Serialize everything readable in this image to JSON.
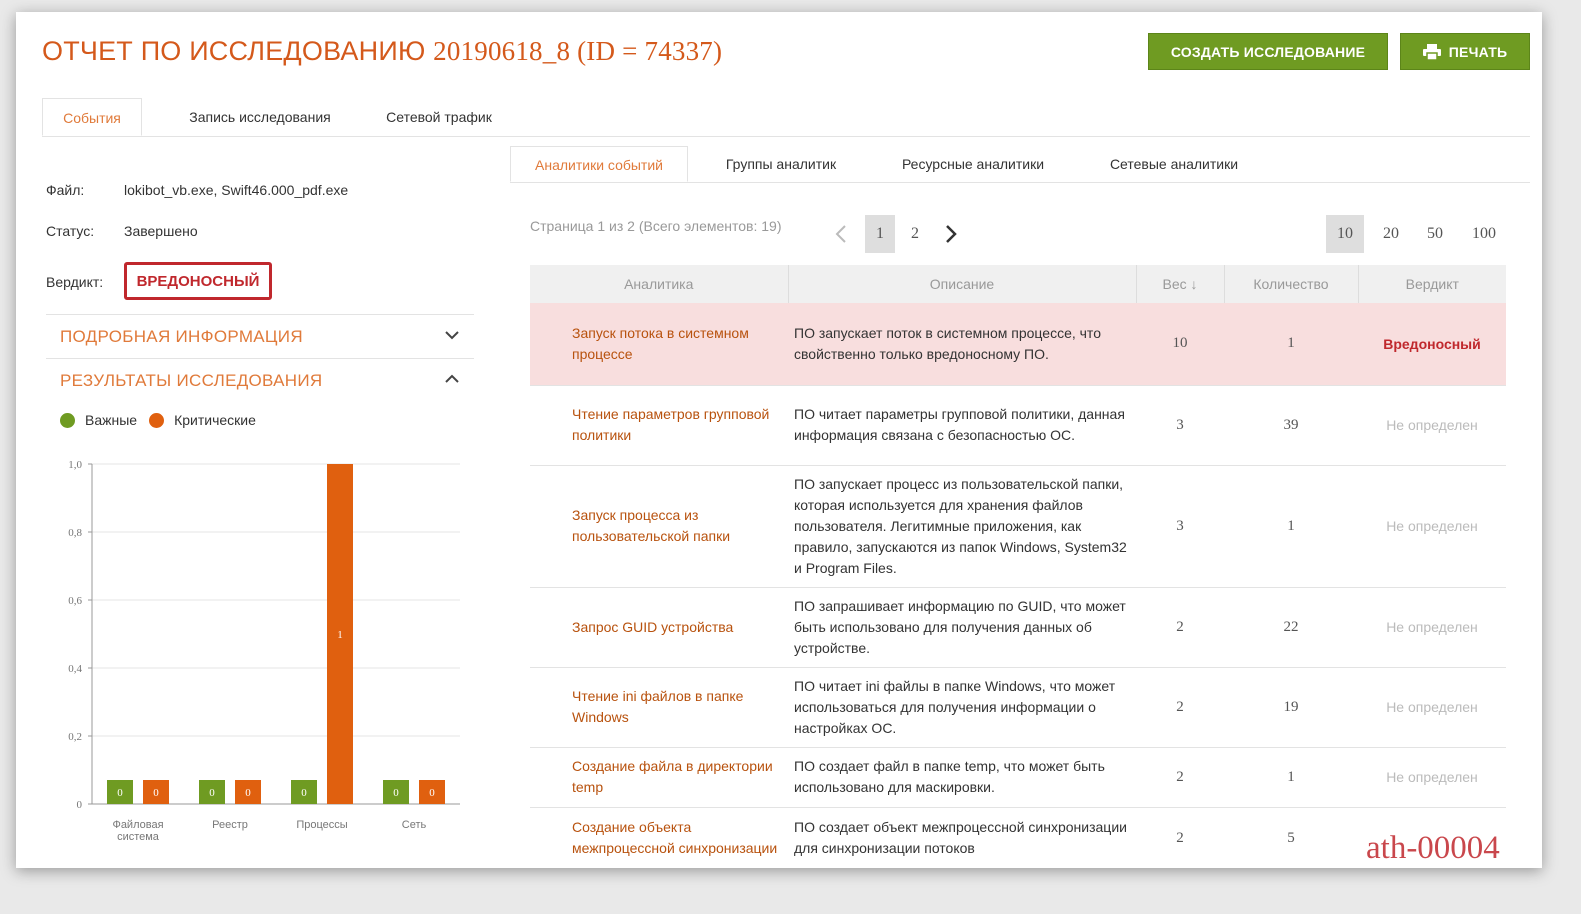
{
  "header": {
    "title_prefix": "ОТЧЕТ ПО ИССЛЕДОВАНИЮ",
    "title_id": "20190618_8 (ID = 74337)",
    "create_button": "СОЗДАТЬ ИССЛЕДОВАНИЕ",
    "print_button": "ПЕЧАТЬ"
  },
  "main_tabs": [
    "События",
    "Запись исследования",
    "Сетевой трафик"
  ],
  "info": {
    "file_label": "Файл:",
    "file_value": "lokibot_vb.exe, Swift46.000_pdf.exe",
    "status_label": "Статус:",
    "status_value": "Завершено",
    "verdict_label": "Вердикт:",
    "verdict_value": "ВРЕДОНОСНЫЙ"
  },
  "sections": {
    "details": "ПОДРОБНАЯ ИНФОРМАЦИЯ",
    "results": "РЕЗУЛЬТАТЫ ИССЛЕДОВАНИЯ"
  },
  "legend": {
    "important": "Важные",
    "critical": "Критические"
  },
  "colors": {
    "important": "#6f9b22",
    "critical": "#e0600f",
    "accent": "#d4591b",
    "malicious": "#c0282d"
  },
  "chart_data": {
    "type": "bar",
    "categories": [
      "Файловая система",
      "Реестр",
      "Процессы",
      "Сеть"
    ],
    "series": [
      {
        "name": "Важные",
        "values": [
          0,
          0,
          0,
          0
        ]
      },
      {
        "name": "Критические",
        "values": [
          0,
          0,
          1,
          0
        ]
      }
    ],
    "ylim": [
      0,
      1.0
    ],
    "yticks": [
      "0",
      "0,2",
      "0,4",
      "0,6",
      "0,8",
      "1,0"
    ],
    "grid": true
  },
  "sub_tabs": [
    "Аналитики событий",
    "Группы аналитик",
    "Ресурсные аналитики",
    "Сетевые аналитики"
  ],
  "pagination": {
    "summary": "Страница 1 из 2 (Всего элементов: 19)",
    "pages": [
      "1",
      "2"
    ],
    "page_sizes": [
      "10",
      "20",
      "50",
      "100"
    ]
  },
  "table": {
    "headers": [
      "Аналитика",
      "Описание",
      "Вес ↓",
      "Количество",
      "Вердикт"
    ],
    "rows": [
      {
        "analytic": "Запуск потока в системном процессе",
        "description": "ПО запускает поток в системном процессе, что свойственно только вредоносному ПО.",
        "weight": "10",
        "count": "1",
        "verdict": "Вредоносный",
        "bad": true
      },
      {
        "analytic": "Чтение параметров групповой политики",
        "description": "ПО читает параметры групповой политики, данная информация связана с безопасностью ОС.",
        "weight": "3",
        "count": "39",
        "verdict": "Не определен",
        "bad": false
      },
      {
        "analytic": "Запуск процесса из пользовательской папки",
        "description": "ПО запускает процесс из пользовательской папки, которая используется для хранения файлов пользователя. Легитимные приложения, как правило, запускаются из папок Windows, System32 и Program Files.",
        "weight": "3",
        "count": "1",
        "verdict": "Не определен",
        "bad": false
      },
      {
        "analytic": "Запрос GUID устройства",
        "description": "ПО запрашивает информацию по GUID, что может быть использовано для получения данных об устройстве.",
        "weight": "2",
        "count": "22",
        "verdict": "Не определен",
        "bad": false
      },
      {
        "analytic": "Чтение ini файлов в папке Windows",
        "description": "ПО читает ini файлы в папке Windows, что может использоваться для получения информации о настройках ОС.",
        "weight": "2",
        "count": "19",
        "verdict": "Не определен",
        "bad": false
      },
      {
        "analytic": "Создание файла в директории temp",
        "description": "ПО создает файл в папке temp, что может быть использовано для маскировки.",
        "weight": "2",
        "count": "1",
        "verdict": "Не определен",
        "bad": false
      },
      {
        "analytic": "Создание объекта межпроцессной синхронизации",
        "description": "ПО создает объект межпроцессной синхронизации для синхронизации потоков",
        "weight": "2",
        "count": "5",
        "verdict": "",
        "bad": false
      }
    ]
  },
  "watermark": "ath-00004"
}
